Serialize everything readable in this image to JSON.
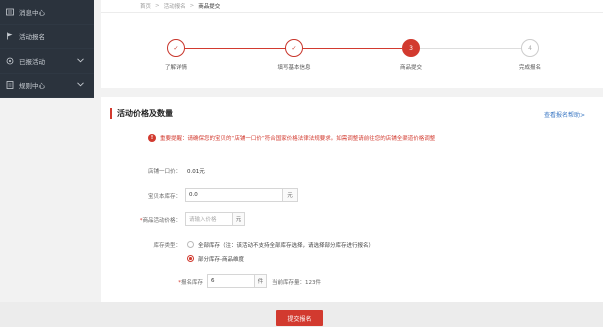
{
  "sidebar": {
    "items": [
      {
        "label": "消息中心",
        "icon": "message-icon"
      },
      {
        "label": "活动报名",
        "icon": "flag-icon"
      },
      {
        "label": "已报活动",
        "icon": "gear-icon"
      },
      {
        "label": "规则中心",
        "icon": "document-icon"
      }
    ]
  },
  "breadcrumb": {
    "home": "首页",
    "sep1": ">",
    "level2": "活动报名",
    "sep2": ">",
    "current": "商品提交"
  },
  "steps": [
    {
      "label": "了解详情",
      "mark": "✓",
      "state": "done"
    },
    {
      "label": "填写基本信息",
      "mark": "✓",
      "state": "done"
    },
    {
      "label": "商品提交",
      "mark": "3",
      "state": "active"
    },
    {
      "label": "完成报名",
      "mark": "4",
      "state": "todo"
    }
  ],
  "section": {
    "title": "活动价格及数量",
    "help_link": "查看报名帮助>"
  },
  "notice": {
    "icon_text": "!",
    "text": "重要提醒：请确保您的宝贝的“店铺一口价”符合国家价格法律法规要求。如需调整请前往您的店铺全渠道价格调整"
  },
  "form": {
    "shop_price": {
      "label": "店铺一口价：",
      "value": "0.01元"
    },
    "sku_stock": {
      "label": "宝贝本库存：",
      "value": "0.0",
      "unit": "元"
    },
    "activity_price": {
      "required": "*",
      "label": "商品活动价格：",
      "placeholder": "请输入价格",
      "unit": "元"
    },
    "stock_type": {
      "label": "库存类型：",
      "options": [
        {
          "text": "全部库存（注：该活动不支持全部库存选择，请选择部分库存进行报名）",
          "selected": false
        },
        {
          "text": "部分库存-商品维度",
          "selected": true
        }
      ]
    },
    "signup_stock": {
      "required": "*",
      "label": "报名库存",
      "value": "6",
      "unit": "件",
      "current_text": "当前库存量：123件"
    }
  },
  "actions": {
    "submit_label": "提交报名"
  },
  "colors": {
    "accent": "#d23a2f",
    "sidebar": "#2b333d",
    "link": "#3b78c4"
  }
}
